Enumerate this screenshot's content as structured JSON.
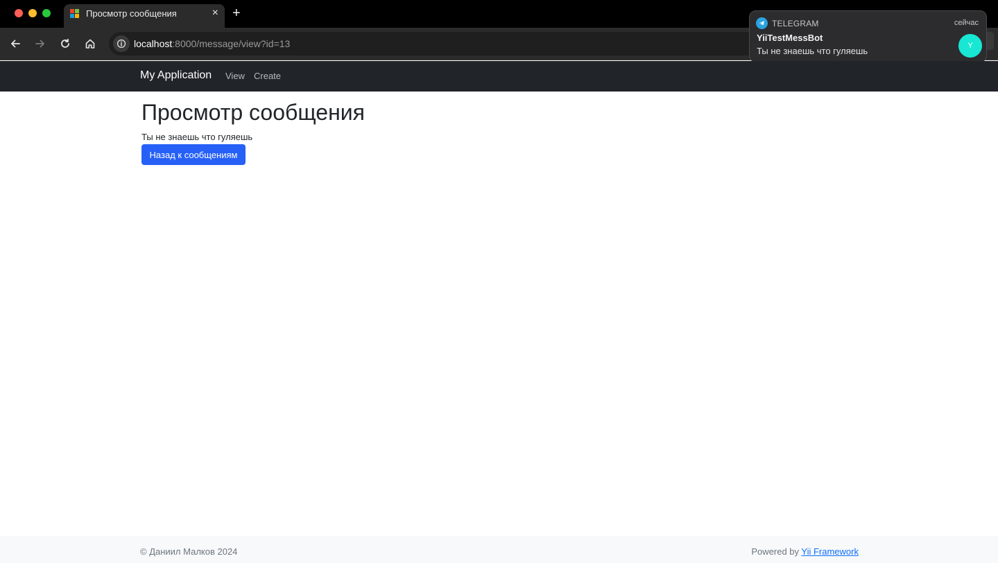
{
  "browser": {
    "tab_title": "Просмотр сообщения",
    "tab_close": "×",
    "new_tab": "+",
    "url_host": "localhost",
    "url_path": ":8000/message/view?id=13"
  },
  "notification": {
    "app": "TELEGRAM",
    "time": "сейчас",
    "title": "YiiTestMessBot",
    "body": "Ты не знаешь что гуляешь",
    "avatar_letter": "Y"
  },
  "navbar": {
    "brand": "My Application",
    "links": [
      "View",
      "Create"
    ]
  },
  "main": {
    "title": "Просмотр сообщения",
    "message": "Ты не знаешь что гуляешь",
    "back_button": "Назад к сообщениям"
  },
  "footer": {
    "copyright": "© Даниил Малков 2024",
    "powered_prefix": "Powered by ",
    "powered_link": "Yii Framework"
  },
  "colors": {
    "primary": "#2660f7",
    "navbar_bg": "#212529",
    "avatar": "#18e7d4"
  }
}
